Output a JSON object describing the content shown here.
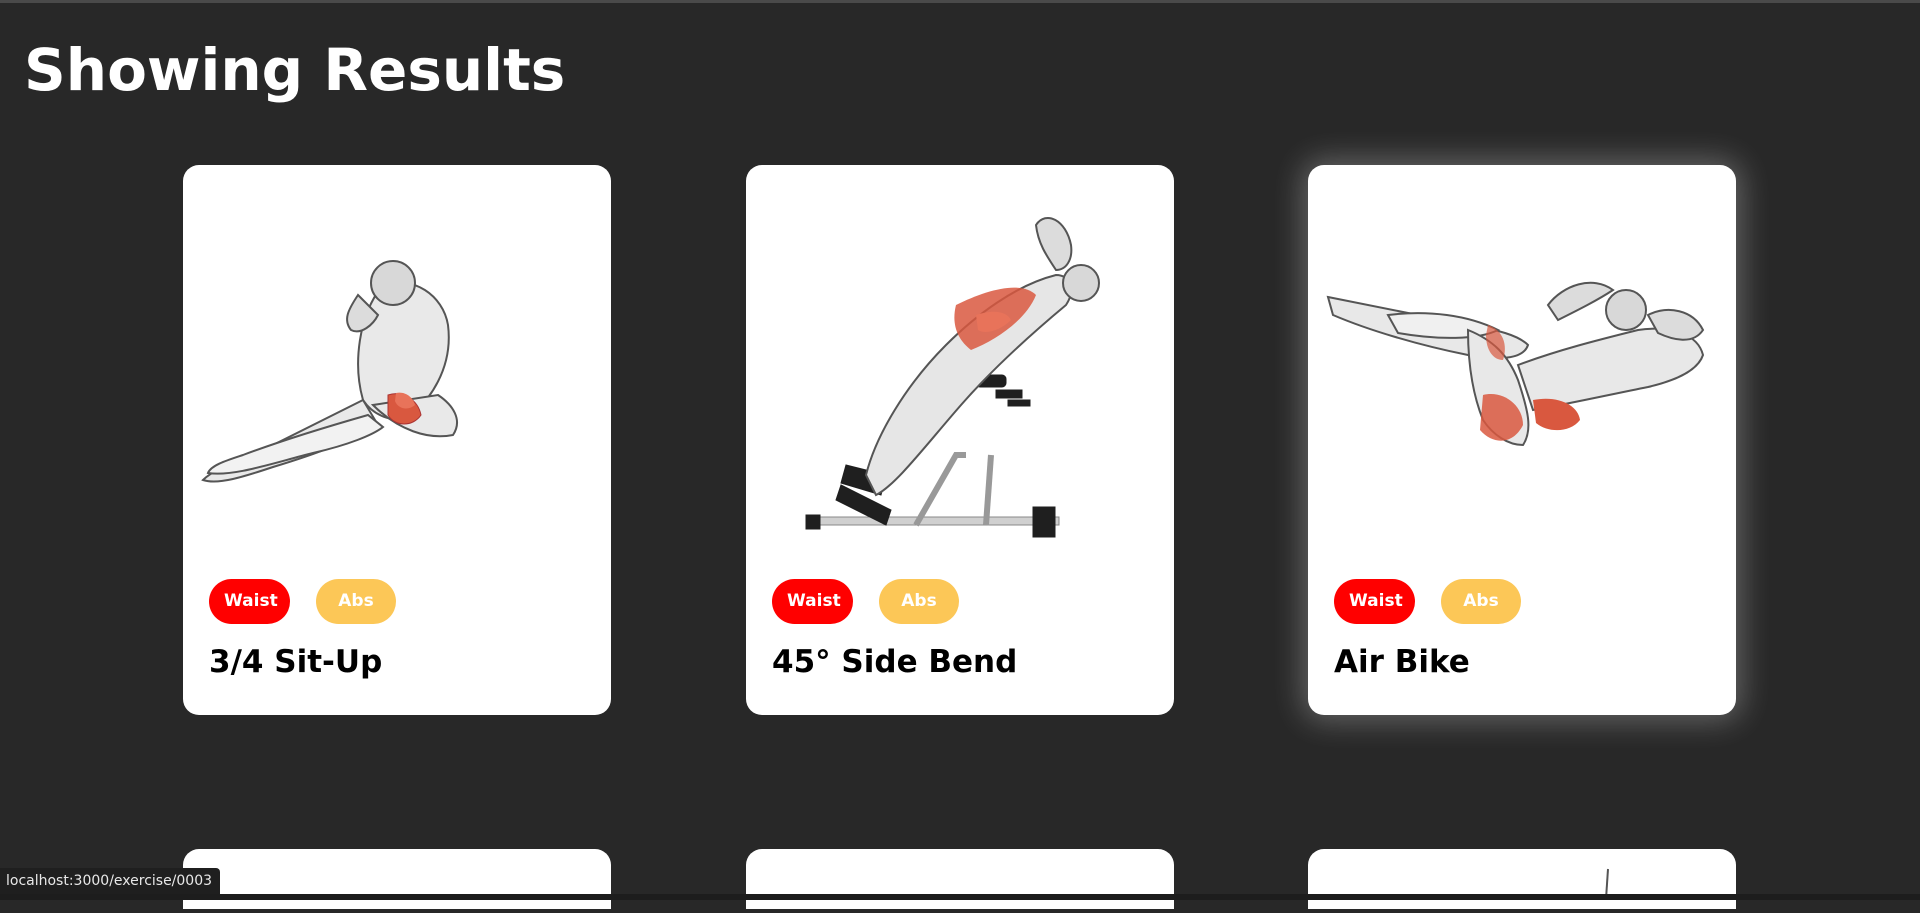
{
  "page": {
    "title": "Showing Results"
  },
  "cards": [
    {
      "name": "3/4 Sit-Up",
      "body_part": "Waist",
      "target": "Abs",
      "image": "muscle-figure-sit-up"
    },
    {
      "name": "45° Side Bend",
      "body_part": "Waist",
      "target": "Abs",
      "image": "muscle-figure-side-bend-bench"
    },
    {
      "name": "Air Bike",
      "body_part": "Waist",
      "target": "Abs",
      "image": "muscle-figure-air-bike"
    }
  ],
  "status_bar": {
    "url": "localhost:3000/exercise/0003"
  },
  "colors": {
    "background": "#282828",
    "body_part_badge": "#ff0000",
    "target_badge": "#fcc757",
    "card": "#ffffff"
  }
}
